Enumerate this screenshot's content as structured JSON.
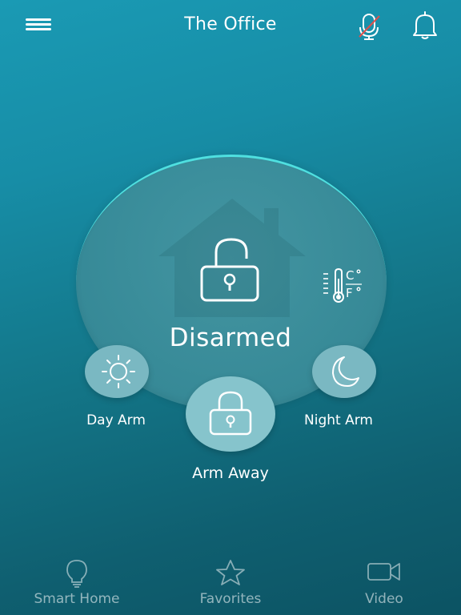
{
  "header": {
    "title": "The Office",
    "menu_icon": "hamburger-menu-icon",
    "mic_icon": "microphone-muted-icon",
    "bell_icon": "bell-icon"
  },
  "status": {
    "state": "Disarmed",
    "lock_icon": "unlocked-padlock-icon",
    "temperature_icon": "thermometer-celsius-fahrenheit-icon"
  },
  "arm_modes": {
    "day": {
      "label": "Day Arm",
      "icon": "sun-icon"
    },
    "away": {
      "label": "Arm Away",
      "icon": "locked-padlock-icon"
    },
    "night": {
      "label": "Night Arm",
      "icon": "crescent-moon-icon"
    }
  },
  "bottom_nav": {
    "items": [
      {
        "label": "Smart Home",
        "icon": "lightbulb-icon"
      },
      {
        "label": "Favorites",
        "icon": "star-icon"
      },
      {
        "label": "Video",
        "icon": "video-camera-icon"
      }
    ]
  },
  "colors": {
    "accent_ring": "#4fe0e0",
    "mic_slash": "#d9534f",
    "arm_button": "#7ab8c2"
  }
}
